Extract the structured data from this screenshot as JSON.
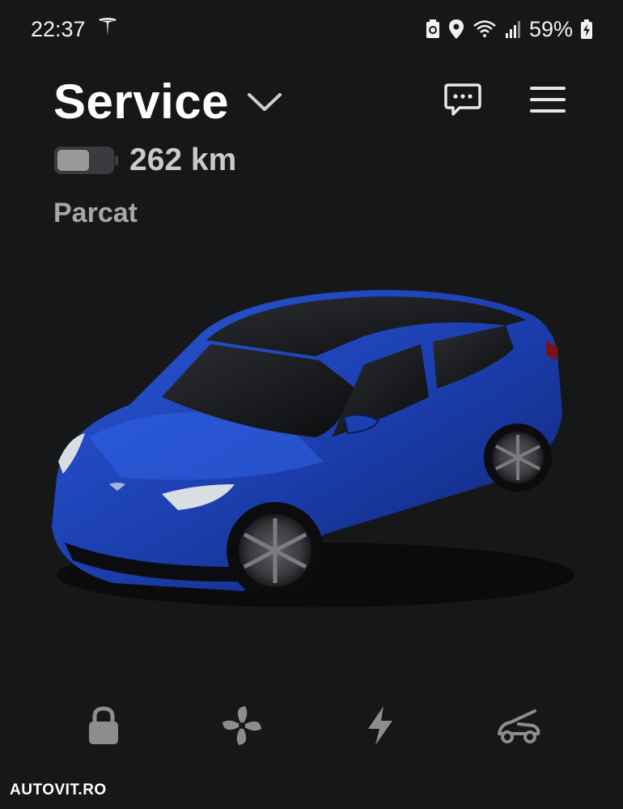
{
  "status_bar": {
    "time": "22:37",
    "battery_percent": "59%",
    "icons": [
      "tesla-logo-icon",
      "battery-saver-icon",
      "location-icon",
      "wifi-icon",
      "signal-icon",
      "battery-charging-icon"
    ]
  },
  "header": {
    "vehicle_name": "Service",
    "icons": [
      "chevron-down-icon",
      "chat-icon",
      "menu-icon"
    ]
  },
  "vehicle": {
    "range": "262 km",
    "battery_level": 0.59,
    "state": "Parcat",
    "paint_color": "#1c3fb0"
  },
  "controls": [
    {
      "name": "lock",
      "icon": "lock-icon"
    },
    {
      "name": "climate",
      "icon": "fan-icon"
    },
    {
      "name": "charge",
      "icon": "lightning-icon"
    },
    {
      "name": "trunk",
      "icon": "frunk-icon"
    }
  ],
  "watermark": "AUTOVIT.RO"
}
